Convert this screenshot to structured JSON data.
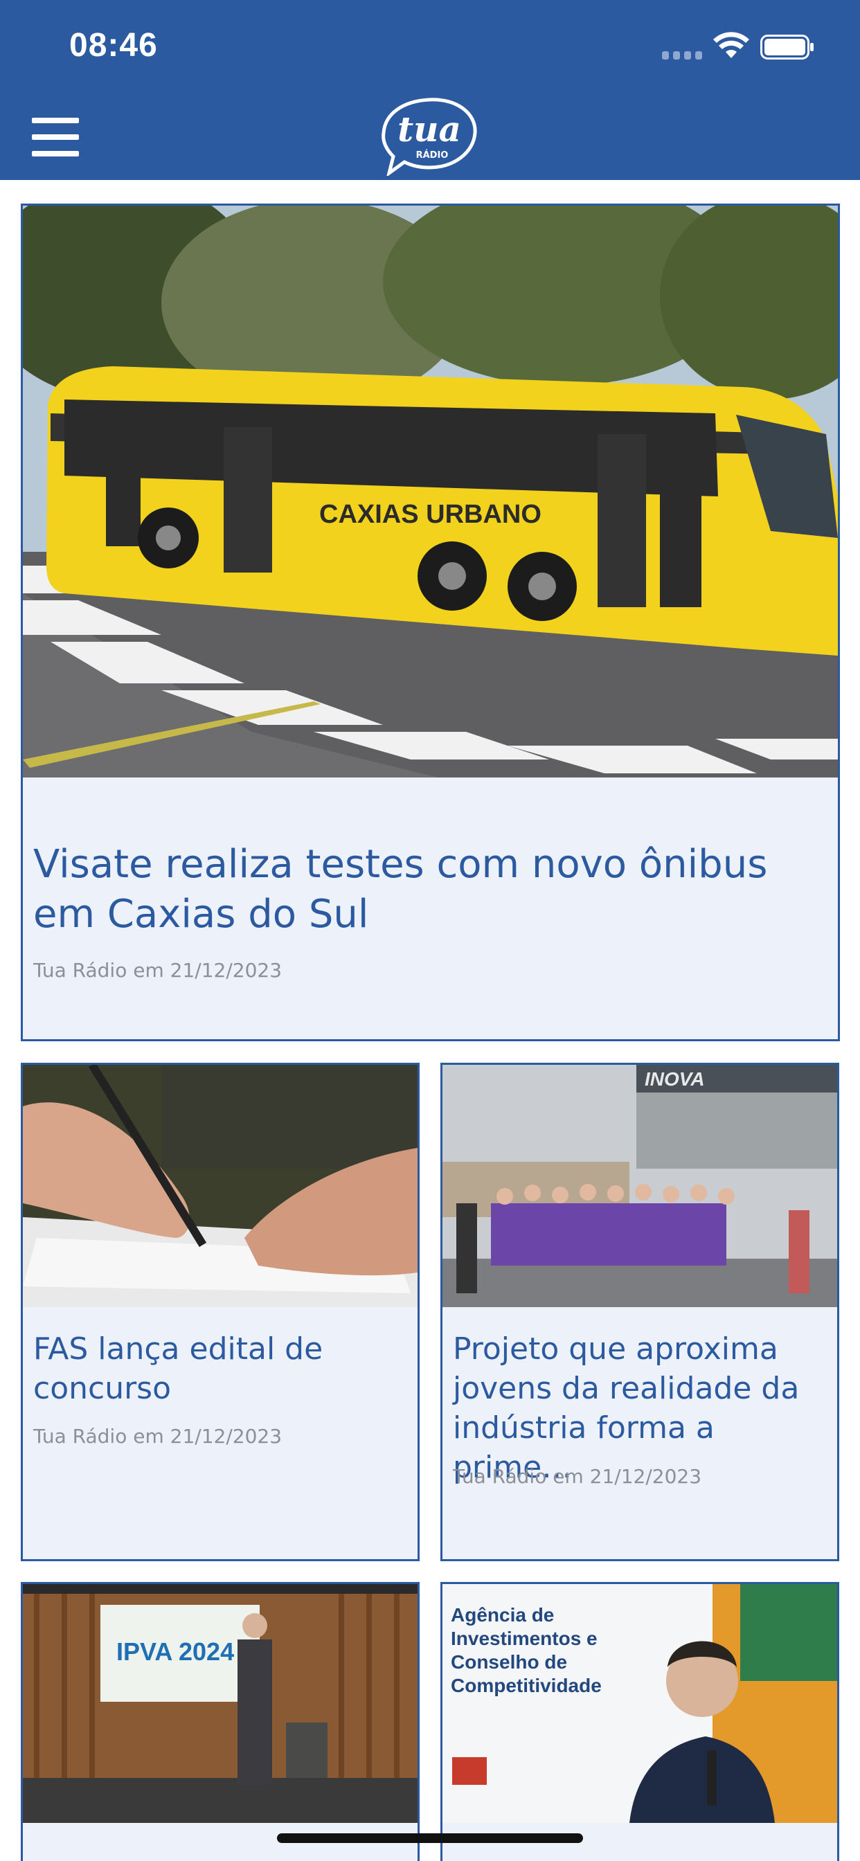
{
  "status_bar": {
    "time": "08:46"
  },
  "app": {
    "logo_text": "tua",
    "logo_subtext": "RÁDIO"
  },
  "articles": [
    {
      "title": "Visate realiza testes com novo ônibus em Caxias do Sul",
      "meta": "Tua Rádio em 21/12/2023",
      "image_text": "CAXIAS URBANO"
    },
    {
      "title": "FAS lança edital de concurso",
      "meta": "Tua Rádio em 21/12/2023"
    },
    {
      "title": "Projeto que aproxima jovens da realidade da indústria forma a prime…",
      "meta": "Tua Rádio em 21/12/2023",
      "image_text": "INOVA"
    },
    {
      "title": "",
      "meta": "",
      "image_text": "IPVA 2024"
    },
    {
      "title": "",
      "meta": "",
      "image_text": "Agência de Investimentos e Conselho de Competitividade"
    }
  ],
  "colors": {
    "brand": "#2c5aa0",
    "card_bg": "#edf1f9",
    "meta": "#8a8f99"
  }
}
